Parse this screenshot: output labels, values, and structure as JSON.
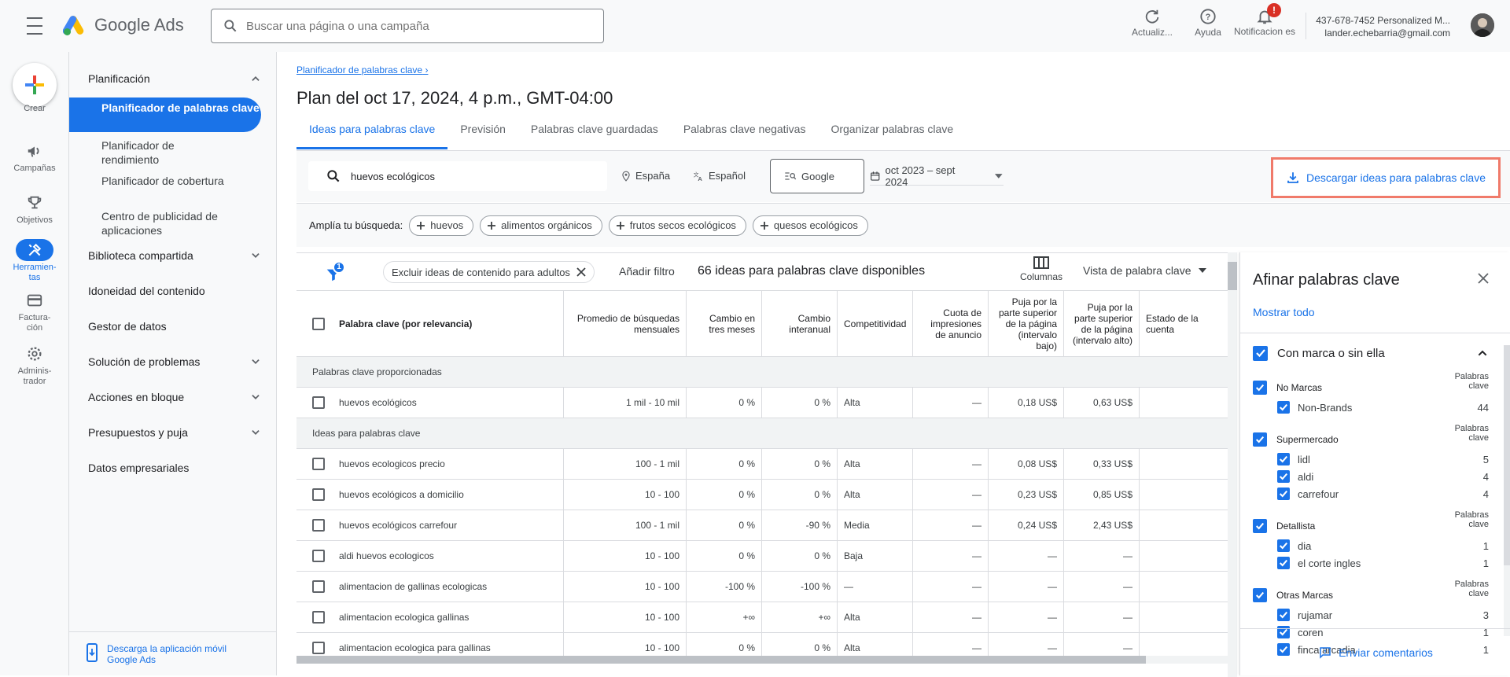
{
  "header": {
    "app_name": "Google Ads",
    "search_placeholder": "Buscar una página o una campaña",
    "refresh_label": "Actualiz...",
    "help_label": "Ayuda",
    "notifications_label": "Notificacion es",
    "notifications_badge": "!",
    "account_name": "437-678-7452 Personalized M...",
    "account_email": "lander.echebarria@gmail.com"
  },
  "left_rail": {
    "items": [
      {
        "label": "Crear",
        "icon": "plus-icon"
      },
      {
        "label": "Campañas",
        "icon": "megaphone-icon"
      },
      {
        "label": "Objetivos",
        "icon": "trophy-icon"
      },
      {
        "label": "Herramien-tas",
        "icon": "tools-icon"
      },
      {
        "label": "Factura-ción",
        "icon": "credit-card-icon"
      },
      {
        "label": "Adminis-trador",
        "icon": "gear-icon"
      }
    ]
  },
  "nav": {
    "planning": "Planificación",
    "sub_items": [
      "Planificador de palabras clave",
      "Planificador de rendimiento",
      "Planificador de cobertura",
      "Centro de publicidad de aplicaciones"
    ],
    "sections": [
      "Biblioteca compartida",
      "Idoneidad del contenido",
      "Gestor de datos",
      "Solución de problemas",
      "Acciones en bloque",
      "Presupuestos y puja",
      "Datos empresariales"
    ],
    "footer": "Descarga la aplicación móvil Google Ads"
  },
  "page": {
    "breadcrumb": "Planificador de palabras clave",
    "title": "Plan del oct 17, 2024, 4 p.m., GMT-04:00",
    "tabs": [
      "Ideas para palabras clave",
      "Previsión",
      "Palabras clave guardadas",
      "Palabras clave negativas",
      "Organizar palabras clave"
    ]
  },
  "search_bar": {
    "keyword": "huevos ecológicos",
    "location": "España",
    "language": "Español",
    "network": "Google",
    "date_range": "oct 2023 – sept 2024",
    "download": "Descargar ideas para palabras clave"
  },
  "expand": {
    "label": "Amplía tu búsqueda:",
    "chips": [
      "huevos",
      "alimentos orgánicos",
      "frutos secos ecológicos",
      "quesos ecológicos"
    ]
  },
  "table_toolbar": {
    "filter_badge": "1",
    "exclude_chip": "Excluir ideas de contenido para adultos",
    "add_filter": "Añadir filtro",
    "count": "66 ideas para palabras clave disponibles",
    "columns": "Columnas",
    "view": "Vista de palabra clave"
  },
  "table": {
    "headers": [
      "Palabra clave (por relevancia)",
      "Promedio de búsquedas mensuales",
      "Cambio en tres meses",
      "Cambio interanual",
      "Competitividad",
      "Cuota de impresiones de anuncio",
      "Puja por la parte superior de la página (intervalo bajo)",
      "Puja por la parte superior de la página (intervalo alto)",
      "Estado de la cuenta"
    ],
    "group_provided": "Palabras clave proporcionadas",
    "group_ideas": "Ideas para palabras clave",
    "provided": [
      [
        "huevos ecológicos",
        "1 mil - 10 mil",
        "0 %",
        "0 %",
        "Alta",
        "—",
        "0,18 US$",
        "0,63 US$",
        ""
      ]
    ],
    "ideas": [
      [
        "huevos ecologicos precio",
        "100 - 1 mil",
        "0 %",
        "0 %",
        "Alta",
        "—",
        "0,08 US$",
        "0,33 US$",
        ""
      ],
      [
        "huevos ecológicos a domicilio",
        "10 - 100",
        "0 %",
        "0 %",
        "Alta",
        "—",
        "0,23 US$",
        "0,85 US$",
        ""
      ],
      [
        "huevos ecológicos carrefour",
        "100 - 1 mil",
        "0 %",
        "-90 %",
        "Media",
        "—",
        "0,24 US$",
        "2,43 US$",
        ""
      ],
      [
        "aldi huevos ecologicos",
        "10 - 100",
        "0 %",
        "0 %",
        "Baja",
        "—",
        "—",
        "—",
        ""
      ],
      [
        "alimentacion de gallinas ecologicas",
        "10 - 100",
        "-100 %",
        "-100 %",
        "—",
        "—",
        "—",
        "—",
        ""
      ],
      [
        "alimentacion ecologica gallinas",
        "10 - 100",
        "+∞",
        "+∞",
        "Alta",
        "—",
        "—",
        "—",
        ""
      ],
      [
        "alimentacion ecologica para gallinas",
        "10 - 100",
        "0 %",
        "0 %",
        "Alta",
        "—",
        "—",
        "—",
        ""
      ]
    ]
  },
  "refine_panel": {
    "title": "Afinar palabras clave",
    "show_all": "Mostrar todo",
    "section_title": "Con marca o sin ella",
    "count_header": "Palabras clave",
    "groups": [
      {
        "name": "No Marcas",
        "items": [
          {
            "label": "Non-Brands",
            "count": "44"
          }
        ]
      },
      {
        "name": "Supermercado",
        "items": [
          {
            "label": "lidl",
            "count": "5"
          },
          {
            "label": "aldi",
            "count": "4"
          },
          {
            "label": "carrefour",
            "count": "4"
          }
        ]
      },
      {
        "name": "Detallista",
        "items": [
          {
            "label": "dia",
            "count": "1"
          },
          {
            "label": "el corte ingles",
            "count": "1"
          }
        ]
      },
      {
        "name": "Otras Marcas",
        "items": [
          {
            "label": "rujamar",
            "count": "3"
          },
          {
            "label": "coren",
            "count": "1"
          },
          {
            "label": "finca arcadia",
            "count": "1"
          }
        ]
      }
    ],
    "feedback": "Enviar comentarios"
  }
}
